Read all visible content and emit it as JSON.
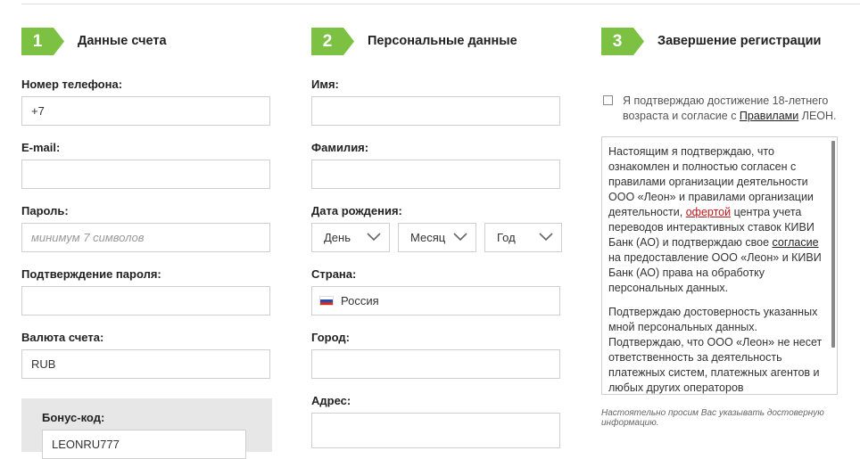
{
  "steps": [
    {
      "number": "1",
      "title": "Данные счета"
    },
    {
      "number": "2",
      "title": "Персональные данные"
    },
    {
      "number": "3",
      "title": "Завершение регистрации"
    }
  ],
  "account": {
    "phone": {
      "label": "Номер телефона:",
      "value": "+7"
    },
    "email": {
      "label": "E-mail:",
      "value": ""
    },
    "password": {
      "label": "Пароль:",
      "placeholder": "минимум 7 символов"
    },
    "password_confirm": {
      "label": "Подтверждение пароля:",
      "value": ""
    },
    "currency": {
      "label": "Валюта счета:",
      "value": "RUB"
    },
    "bonus": {
      "label": "Бонус-код:",
      "value": "LEONRU777"
    }
  },
  "personal": {
    "first_name": {
      "label": "Имя:",
      "value": ""
    },
    "last_name": {
      "label": "Фамилия:",
      "value": ""
    },
    "birth_date": {
      "label": "Дата рождения:",
      "day": "День",
      "month": "Месяц",
      "year": "Год"
    },
    "country": {
      "label": "Страна:",
      "value": "Россия"
    },
    "city": {
      "label": "Город:",
      "value": ""
    },
    "address": {
      "label": "Адрес:",
      "value": ""
    }
  },
  "finish": {
    "consent_prefix": "Я подтверждаю достижение 18-летнего возраста и согласие с ",
    "consent_link": "Правилами",
    "consent_suffix": " ЛЕОН.",
    "terms_p1_a": "Настоящим я подтверждаю, что ознакомлен и полностью согласен с правилами организации деятельности ООО «Леон» и правилами организации деятельности, ",
    "terms_p1_link1": "офертой",
    "terms_p1_b": " центра учета переводов интерактивных ставок КИВИ Банк (АО) и подтверждаю свое ",
    "terms_p1_link2": "согласие",
    "terms_p1_c": " на предоставление ООО «Леон» и КИВИ Банк (АО) права на обработку персональных данных.",
    "terms_p2": "Подтверждаю достоверность указанных мной персональных данных. Подтверждаю, что ООО «Леон» не несет ответственность за деятельность платежных систем, платежных агентов и любых других операторов",
    "note": "Настоятельно просим Вас указывать достоверную информацию."
  },
  "colors": {
    "accent": "#7cc142",
    "link_red": "#c0171c"
  },
  "icons": {
    "step_badge": "arrow-badge",
    "select": "chevron-down-icon",
    "country": "russia-flag-icon"
  }
}
